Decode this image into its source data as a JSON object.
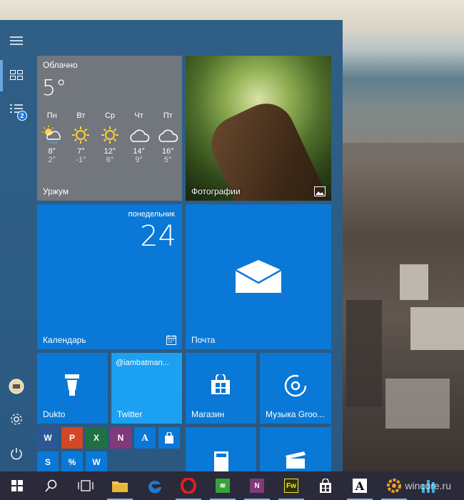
{
  "start_menu": {
    "weather": {
      "condition": "Облачно",
      "temperature": "5°",
      "location": "Уржум",
      "days": [
        {
          "name": "Пн",
          "icon": "rain-sun-icon",
          "high": "8°",
          "low": "2°"
        },
        {
          "name": "Вт",
          "icon": "sun-icon",
          "high": "7°",
          "low": "-1°"
        },
        {
          "name": "Ср",
          "icon": "sun-icon",
          "high": "12°",
          "low": "6°"
        },
        {
          "name": "Чт",
          "icon": "cloud-icon",
          "high": "14°",
          "low": "9°"
        },
        {
          "name": "Пт",
          "icon": "cloud-icon",
          "high": "16°",
          "low": "5°"
        }
      ]
    },
    "photos": {
      "label": "Фотографии"
    },
    "calendar": {
      "label": "Календарь",
      "weekday": "понедельник",
      "day": "24"
    },
    "mail": {
      "label": "Почта"
    },
    "dukto": {
      "label": "Dukto"
    },
    "twitter": {
      "label": "Twitter",
      "handle": "@iambatman..."
    },
    "store": {
      "label": "Магазин"
    },
    "music": {
      "label": "Музыка Groo..."
    },
    "office_group": [
      {
        "letter": "W",
        "color": "#2b5797",
        "icon": "word-icon"
      },
      {
        "letter": "P",
        "color": "#d24726",
        "icon": "powerpoint-icon"
      },
      {
        "letter": "X",
        "color": "#1e7145",
        "icon": "excel-icon"
      },
      {
        "letter": "N",
        "color": "#80397b",
        "icon": "onenote-icon"
      },
      {
        "letter": "A",
        "color": "#ffffff",
        "icon": "font-app-icon"
      },
      {
        "letter": "",
        "color": "#0a78d6",
        "icon": "store-small-icon"
      },
      {
        "letter": "S",
        "color": "#0a78d6",
        "icon": "sway-icon"
      },
      {
        "letter": "%",
        "color": "#0a78d6",
        "icon": "percent-icon"
      },
      {
        "letter": "W",
        "color": "#0a78d6",
        "icon": "word-blue-icon"
      }
    ]
  },
  "taskbar": {
    "items": [
      {
        "name": "start",
        "icon": "windows-icon"
      },
      {
        "name": "search",
        "icon": "search-icon"
      },
      {
        "name": "task-view",
        "icon": "task-view-icon"
      },
      {
        "name": "explorer",
        "icon": "folder-icon",
        "color": "#f2c94c"
      },
      {
        "name": "edge",
        "icon": "edge-icon",
        "color": "#1f78d1"
      },
      {
        "name": "opera",
        "icon": "opera-icon",
        "color": "#e0201b"
      },
      {
        "name": "app-green",
        "icon": "green-app-icon",
        "color": "#3aa13a"
      },
      {
        "name": "onenote",
        "icon": "onenote-icon",
        "color": "#80397b"
      },
      {
        "name": "fireworks",
        "icon": "fireworks-icon",
        "color": "#333300",
        "text": "Fw"
      },
      {
        "name": "store",
        "icon": "store-icon",
        "color": "#ffffff"
      },
      {
        "name": "font-app",
        "icon": "font-app-icon",
        "color": "#ffffff",
        "text": "A"
      },
      {
        "name": "settings-app",
        "icon": "gear-color-icon",
        "color": "#f0a020"
      },
      {
        "name": "bars-app",
        "icon": "bars-app-icon",
        "color": "#3bb0e0"
      }
    ]
  },
  "watermark": "wincore.ru"
}
